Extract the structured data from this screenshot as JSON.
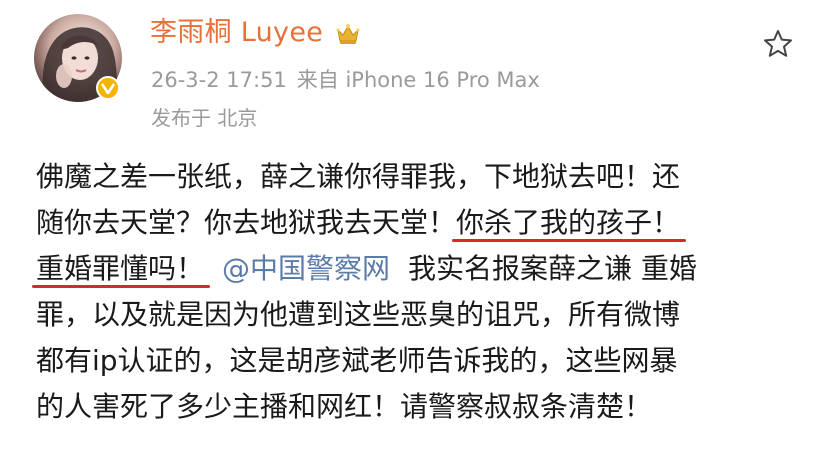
{
  "post": {
    "author": {
      "name": "李雨桐 Luyee",
      "avatar_icon": "avatar-photo",
      "verified_icon": "verified-badge-icon",
      "badge_icon": "crown-icon",
      "name_color": "#e8703a"
    },
    "meta": {
      "timestamp": "26-3-2 17:51",
      "source": "来自 iPhone 16 Pro Max",
      "location": "发布于  北京"
    },
    "actions": {
      "favorite_icon": "star-icon"
    },
    "content": {
      "line1": "佛魔之差一张纸，薛之谦你得罪我，下地狱去吧！还",
      "line2_a": "随你去天堂？你去地狱我去天堂！",
      "line2_b": "你杀了我的孩子！",
      "line3_a": "重婚罪懂吗！",
      "line3_mention": "@中国警察网",
      "line3_b": "我实名报案薛之谦 重婚",
      "line4": "罪，以及就是因为他遭到这些恶臭的诅咒，所有微博",
      "line5": "都有ip认证的，这是胡彦斌老师告诉我的，这些网暴",
      "line6": "的人害死了多少主播和网红！请警察叔叔条清楚！"
    },
    "colors": {
      "underline": "#d9282b",
      "mention": "#5b7ba8",
      "meta_text": "#9a9a9a",
      "body_text": "#1a1a1a"
    }
  }
}
